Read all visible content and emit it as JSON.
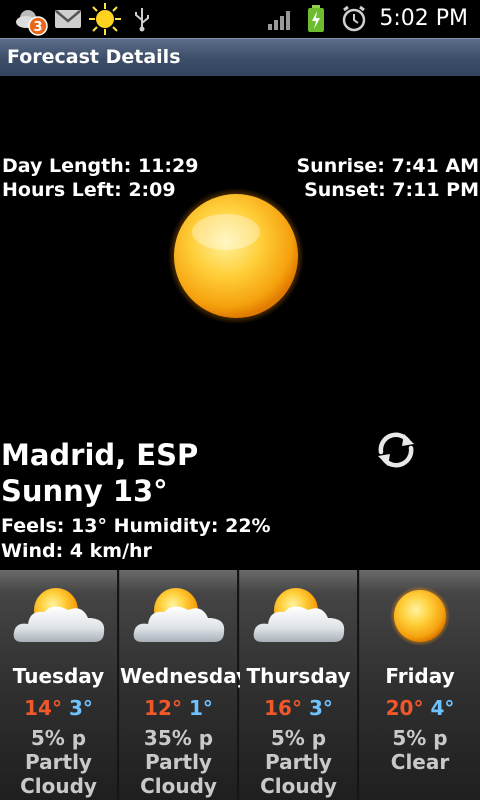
{
  "status_bar": {
    "notification_badge": "3",
    "time": "5:02 PM",
    "icons": [
      "weather-notification-icon",
      "gmail-icon",
      "sun-notification-icon",
      "usb-icon",
      "signal-icon",
      "battery-charging-icon",
      "alarm-icon"
    ]
  },
  "title_bar": {
    "title": "Forecast Details"
  },
  "details": {
    "day_length": "Day Length: 11:29",
    "hours_left": "Hours Left: 2:09",
    "sunrise": "Sunrise: 7:41 AM",
    "sunset": "Sunset: 7:11 PM"
  },
  "current": {
    "location": "Madrid, ESP",
    "condition": "Sunny 13°",
    "feels_humidity": "Feels: 13° Humidity: 22%",
    "wind": "Wind: 4 km/hr",
    "icon": "sun-icon"
  },
  "forecast": [
    {
      "day": "Tuesday",
      "high": "14°",
      "low": "3°",
      "precip": "5% p",
      "cond1": "Partly",
      "cond2": "Cloudy",
      "icon": "partly-cloudy-icon"
    },
    {
      "day": "Wednesday",
      "high": "12°",
      "low": "1°",
      "precip": "35% p",
      "cond1": "Partly",
      "cond2": "Cloudy",
      "icon": "partly-cloudy-icon"
    },
    {
      "day": "Thursday",
      "high": "16°",
      "low": "3°",
      "precip": "5% p",
      "cond1": "Partly",
      "cond2": "Cloudy",
      "icon": "partly-cloudy-icon"
    },
    {
      "day": "Friday",
      "high": "20°",
      "low": "4°",
      "precip": "5% p",
      "cond1": "Clear",
      "cond2": "",
      "icon": "sun-icon"
    }
  ],
  "colors": {
    "high_temp": "#f0582a",
    "low_temp": "#6ec3ff",
    "title_bar": "#3c4d68"
  }
}
